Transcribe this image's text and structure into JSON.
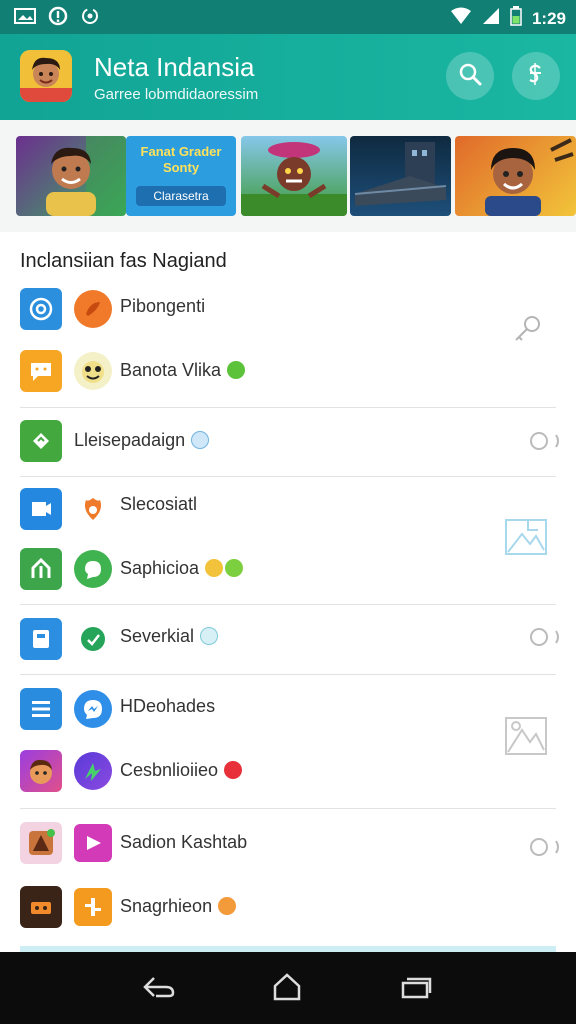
{
  "status_bar": {
    "time": "1:29",
    "icons": [
      "image-icon",
      "alert-icon",
      "sync-icon",
      "wifi-icon",
      "signal-icon",
      "battery-icon"
    ]
  },
  "app_bar": {
    "title": "Neta Indansia",
    "subtitle": "Garree lobmdidaoressim",
    "icons": [
      "search-icon",
      "currency-icon"
    ],
    "colors": {
      "primary": "#11a495",
      "status": "#127f74"
    }
  },
  "banners": [
    {
      "kind": "character-art"
    },
    {
      "kind": "promo",
      "line1": "Fanat Grader",
      "line2": "Sonty",
      "line3": "Clarasetra"
    },
    {
      "kind": "character-art"
    },
    {
      "kind": "scene-art"
    },
    {
      "kind": "character-art"
    }
  ],
  "section": {
    "title": "Inclansiian fas Nagiand"
  },
  "items": [
    {
      "label": "Pibongenti",
      "trailing_icon": "key-icon"
    },
    {
      "label": "Banota Vlika"
    },
    {
      "label": "Lleisepadaign",
      "trailing_icon": "toggle-off-icon"
    },
    {
      "label": "Slecosiatl",
      "trailing_icon": "image-placeholder-icon"
    },
    {
      "label": "Saphicioa"
    },
    {
      "label": "Severkial",
      "trailing_icon": "toggle-off-icon"
    },
    {
      "label": "HDeohades",
      "trailing_icon": "image-placeholder-icon"
    },
    {
      "label": "Cesbnlioiieo"
    },
    {
      "label": "Sadion Kashtab",
      "trailing_icon": "toggle-off-icon"
    },
    {
      "label": "Snagrhieon"
    }
  ],
  "nav_bar": {
    "icons": [
      "back-icon",
      "home-icon",
      "recents-icon"
    ]
  }
}
